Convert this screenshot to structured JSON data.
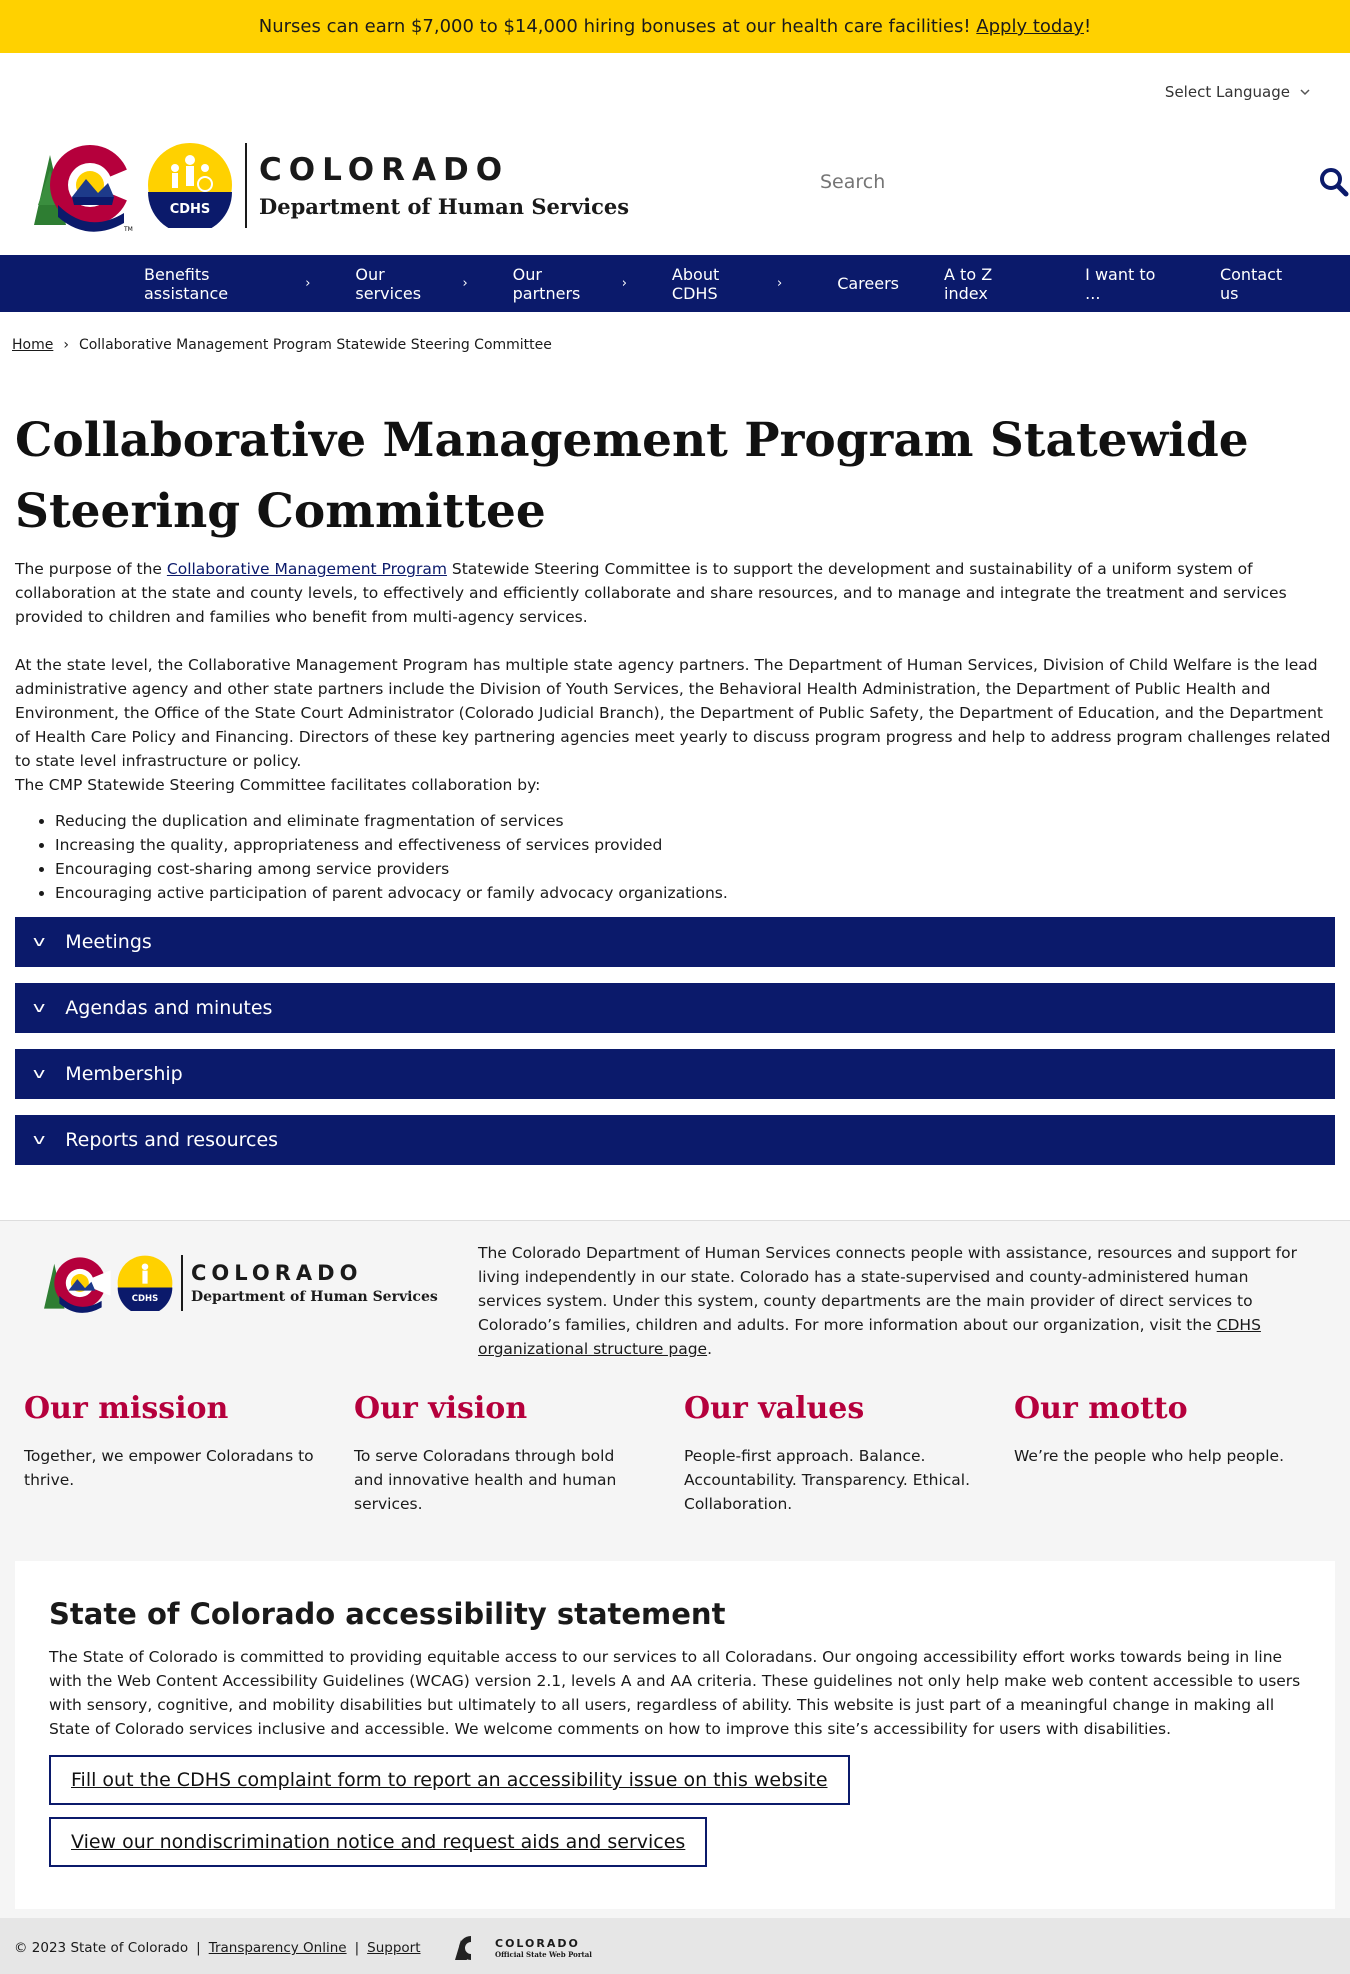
{
  "banner": {
    "text_before": "Nurses can earn $7,000 to $14,000 hiring bonuses at our health care facilities! ",
    "link": "Apply today",
    "text_after": "!"
  },
  "language": {
    "label": "Select Language"
  },
  "header": {
    "logo_state": "COLORADO",
    "logo_dept": "Department of Human Services",
    "logo_badge": "CDHS",
    "tm": "TM"
  },
  "search": {
    "placeholder": "Search"
  },
  "nav": {
    "items": [
      {
        "label": "Benefits assistance",
        "chevron": "›"
      },
      {
        "label": "Our services",
        "chevron": "›"
      },
      {
        "label": "Our partners",
        "chevron": "›"
      },
      {
        "label": "About CDHS",
        "chevron": "›"
      },
      {
        "label": "Careers",
        "chevron": ""
      },
      {
        "label": "A to Z index",
        "chevron": ""
      },
      {
        "label": "I want to ...",
        "chevron": ""
      },
      {
        "label": "Contact us",
        "chevron": ""
      }
    ]
  },
  "breadcrumb": {
    "home": "Home",
    "sep": "›",
    "current": "Collaborative Management Program Statewide Steering Committee"
  },
  "main": {
    "title": "Collaborative Management Program Statewide Steering Committee",
    "p1_before": "The purpose of the ",
    "p1_link": "Collaborative Management Program",
    "p1_after": " Statewide Steering Committee is to support the development and sustainability of a uniform system of collaboration at the state and county levels, to effectively and efficiently collaborate and share resources, and to manage and integrate the treatment and services provided to children and families who benefit from multi-agency services.",
    "p2": "At the state level, the Collaborative Management Program has multiple state agency partners. The Department of Human Services, Division of Child Welfare is the lead administrative agency and other state partners include the Division of Youth Services, the Behavioral Health Administration, the Department of Public Health and Environment, the Office of the State Court Administrator (Colorado Judicial Branch), the Department of Public Safety, the Department of Education, and the Department of Health Care Policy and Financing. Directors of these key partnering agencies meet yearly to discuss program progress and help to address program challenges related to state level infrastructure or policy.",
    "p3": "The CMP Statewide Steering Committee facilitates collaboration by:",
    "bullets": [
      "Reducing the duplication and eliminate fragmentation of services",
      "Increasing the quality, appropriateness and effectiveness of services provided",
      "Encouraging cost-sharing among service providers",
      "Encouraging active participation of parent advocacy or family advocacy organizations."
    ],
    "accordions": [
      {
        "label": "Meetings",
        "chevron": "v"
      },
      {
        "label": "Agendas and minutes",
        "chevron": "v"
      },
      {
        "label": "Membership",
        "chevron": "v"
      },
      {
        "label": "Reports and resources",
        "chevron": "v"
      }
    ]
  },
  "footer": {
    "desc_before": "The Colorado Department of Human Services connects people with assistance, resources and support for living independently in our state. Colorado has a state-supervised and county-administered human services system. Under this system, county departments are the main provider of direct services to Colorado’s families, children and adults. For more information about our organization, visit the ",
    "desc_link": "CDHS organizational structure page",
    "desc_after": ".",
    "pillars": [
      {
        "title": "Our mission",
        "text": "Together, we empower Coloradans to thrive."
      },
      {
        "title": "Our vision",
        "text": "To serve Coloradans through bold and innovative health and human services."
      },
      {
        "title": "Our values",
        "text": "People-first approach. Balance. Accountability. Transparency. Ethical. Collaboration."
      },
      {
        "title": "Our motto",
        "text": "We’re the people who help people."
      }
    ],
    "a11y": {
      "title": "State of Colorado accessibility statement",
      "text": "The State of Colorado is committed to providing equitable access to our services to all Coloradans. Our ongoing accessibility effort works towards being in line with the Web Content Accessibility Guidelines (WCAG) version 2.1, levels A and AA criteria. These guidelines not only help make web content accessible to users with sensory, cognitive, and mobility disabilities but ultimately to all users, regardless of ability. This website is just part of a meaningful change in making all State of Colorado services inclusive and accessible. We welcome comments on how to improve this site’s accessibility for users with disabilities.",
      "button1": "Fill out the CDHS complaint form to report an accessibility issue on this website",
      "button2": "View our nondiscrimination notice and request aids and services"
    },
    "copyright": "© 2023 State of Colorado",
    "sep": "|",
    "link_transparency": "Transparency Online",
    "link_support": "Support",
    "portal_state": "COLORADO",
    "portal_label": "Official State Web Portal"
  },
  "colors": {
    "banner": "#ffd100",
    "navy": "#0b1a6b",
    "crimson": "#b5003c"
  }
}
